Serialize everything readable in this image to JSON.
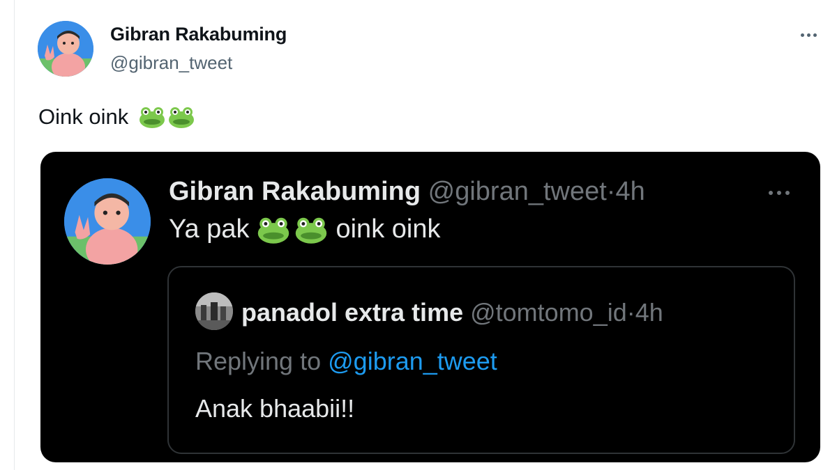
{
  "tweet": {
    "author_name": "Gibran Rakabuming",
    "author_handle": "@gibran_tweet",
    "text": "Oink oink",
    "emoji": "frog-icon",
    "emoji_count": 2,
    "more_icon": "more-icon"
  },
  "quoted": {
    "author_name": "Gibran Rakabuming",
    "author_handle": "@gibran_tweet",
    "separator": "·",
    "time": "4h",
    "text_before": "Ya pak",
    "text_after": "oink oink",
    "emoji": "frog-icon",
    "emoji_count": 2,
    "more_icon": "more-icon",
    "reply_to_card": {
      "author_name": "panadol extra time",
      "author_handle": "@tomtomo_id",
      "separator": "·",
      "time": "4h",
      "replying_label": "Replying to",
      "replying_mention": "@gibran_tweet",
      "text": "Anak bhaabii!!"
    }
  },
  "colors": {
    "dark_bg": "#000000",
    "link": "#1d9bf0",
    "muted_light": "#536471",
    "muted_dark": "#71767b",
    "text_dark": "#e7e9ea"
  }
}
